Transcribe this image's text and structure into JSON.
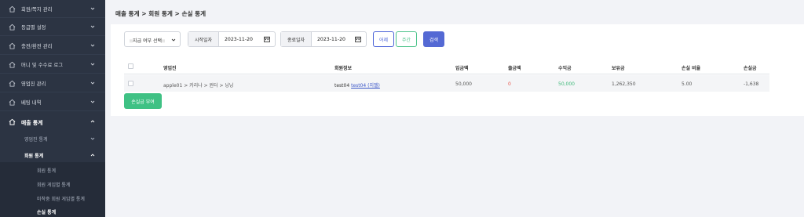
{
  "sidebar": {
    "items": [
      {
        "label": "회원/쪽지 관리",
        "icon": "home-icon"
      },
      {
        "label": "등급별 설정",
        "icon": "home-icon"
      },
      {
        "label": "충전/환전 관리",
        "icon": "home-icon"
      },
      {
        "label": "머니 및 수수료 로그",
        "icon": "home-icon"
      },
      {
        "label": "영업진 관리",
        "icon": "home-icon"
      },
      {
        "label": "베팅 내역",
        "icon": "home-icon"
      },
      {
        "label": "매출 통계",
        "icon": "home-icon"
      }
    ],
    "sub": {
      "partner_stats": "영업진 통계",
      "member_stats": "회원 통계",
      "member_stats_children": [
        "회원 통계",
        "회원 게임별 통계",
        "미착중 회원 게임별 통계",
        "손실 통계"
      ]
    }
  },
  "breadcrumb": "매출 통계 > 회원 통계 > 손실 통계",
  "filter": {
    "select_value": "::지급 여부 선택::",
    "start_label": "시작일자",
    "start_value": "2023-11-20",
    "end_label": "종료일자",
    "end_value": "2023-11-20",
    "yesterday": "어제",
    "week": "주간",
    "search": "검색"
  },
  "table": {
    "headers": [
      "영업진",
      "회원정보",
      "입금액",
      "출금액",
      "수익금",
      "보유금",
      "손실 비율",
      "손실금"
    ],
    "row": {
      "partner": "apple01 > 카리나 > 윈터 > 닝닝",
      "member_id": "test04",
      "member_link": "test04 (지젤)",
      "deposit": "50,000",
      "withdraw": "0",
      "profit": "50,000",
      "balance": "1,262,350",
      "loss_rate": "5.00",
      "loss": "-1,638"
    }
  },
  "award_button": "손실금 부여",
  "colors": {
    "sidebar": "#2c3443",
    "primary": "#5469d4",
    "success": "#3fc184"
  }
}
